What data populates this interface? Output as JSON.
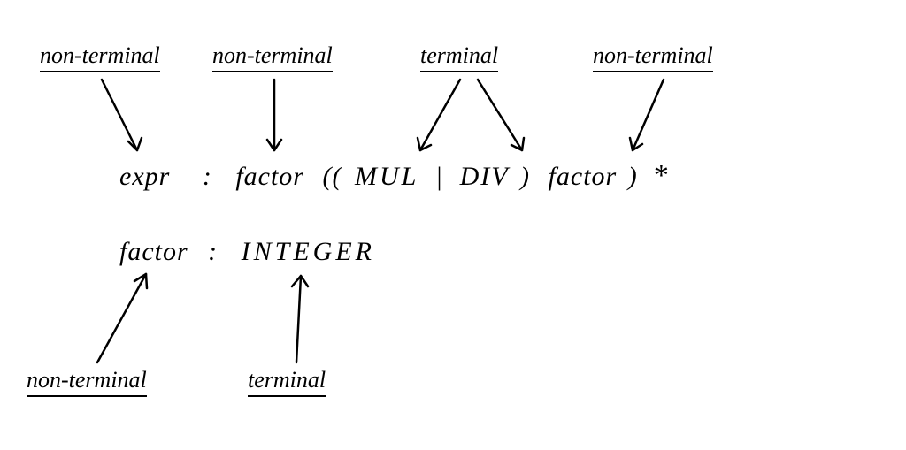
{
  "labels": {
    "top1": "non-terminal",
    "top2": "non-terminal",
    "top3": "terminal",
    "top4": "non-terminal",
    "bottom1": "non-terminal",
    "bottom2": "terminal"
  },
  "grammar": {
    "rule1": {
      "lhs": "expr",
      "colon": ":",
      "rhs_factor1": "factor",
      "rhs_group_open": "((",
      "rhs_mul": "MUL",
      "rhs_pipe": "|",
      "rhs_div": "DIV",
      "rhs_group_close": ")",
      "rhs_factor2": "factor",
      "rhs_close": ")",
      "rhs_star": "*"
    },
    "rule2": {
      "lhs": "factor",
      "colon": ":",
      "rhs": "INTEGER"
    }
  }
}
